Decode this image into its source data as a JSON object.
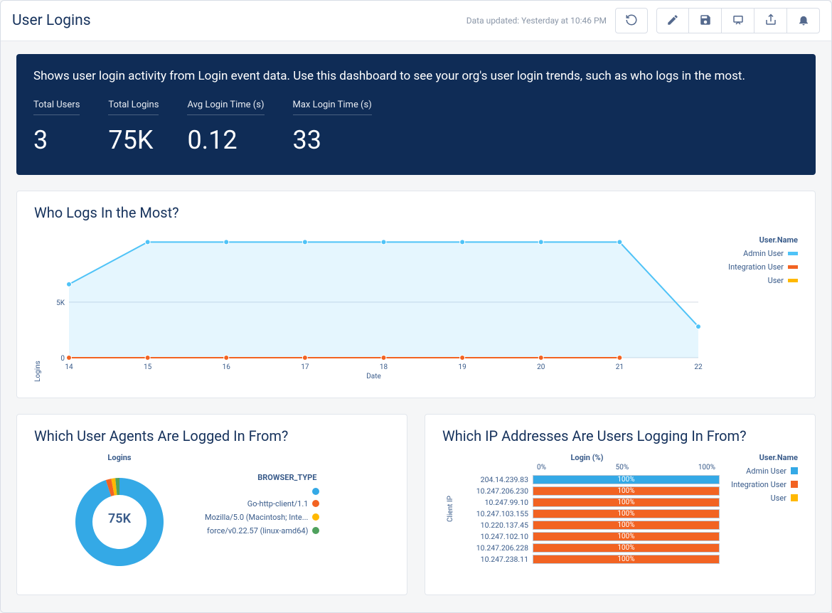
{
  "header": {
    "title": "User Logins",
    "data_updated": "Data updated: Yesterday at 10:46 PM"
  },
  "toolbar_icons": [
    "undo-icon",
    "edit-icon",
    "save-icon",
    "present-icon",
    "share-icon",
    "notify-icon"
  ],
  "description": "Shows user login activity from Login event data. Use this dashboard to see your org's user login trends, such as who logs in the most.",
  "metrics": [
    {
      "label": "Total Users",
      "value": "3"
    },
    {
      "label": "Total Logins",
      "value": "75K"
    },
    {
      "label": "Avg Login Time (s)",
      "value": "0.12"
    },
    {
      "label": "Max Login Time (s)",
      "value": "33"
    }
  ],
  "colors": {
    "admin_user": "#4fc3f7",
    "integration_user": "#f26322",
    "user": "#ffb800",
    "go_http": "#f26322",
    "mozilla": "#ffb800",
    "force": "#4fa15d",
    "browser_unknown": "#34a9e6",
    "grid": "#d3dbe4",
    "axis_text": "#395b8a"
  },
  "chart_data": [
    {
      "id": "line",
      "title": "Who Logs In the Most?",
      "type": "line",
      "xlabel": "Date",
      "ylabel": "Logins",
      "x_ticks": [
        "14",
        "15",
        "16",
        "17",
        "18",
        "19",
        "20",
        "21",
        "22"
      ],
      "y_ticks": [
        {
          "v": 0,
          "label": "0"
        },
        {
          "v": 5000,
          "label": "5K"
        }
      ],
      "ymax": 11000,
      "legend_title": "User.Name",
      "series": [
        {
          "name": "Admin User",
          "color": "#4fc3f7",
          "values": [
            6600,
            10400,
            10400,
            10400,
            10400,
            10400,
            10400,
            10400,
            2800
          ]
        },
        {
          "name": "Integration User",
          "color": "#f26322",
          "values": [
            0,
            0,
            0,
            0,
            0,
            0,
            0,
            0
          ]
        },
        {
          "name": "User",
          "color": "#ffb800",
          "values": []
        }
      ]
    },
    {
      "id": "donut",
      "title": "Which User Agents Are Logged In From?",
      "type": "pie",
      "center_label": "75K",
      "axis_title": "Logins",
      "legend_title": "BROWSER_TYPE",
      "slices": [
        {
          "name": "",
          "color": "#34a9e6",
          "pct": 95
        },
        {
          "name": "Go-http-client/1.1",
          "color": "#f26322",
          "pct": 2
        },
        {
          "name": "Mozilla/5.0 (Macintosh; Inte...",
          "color": "#ffb800",
          "pct": 1.5
        },
        {
          "name": "force/v0.22.57 (linux-amd64)",
          "color": "#4fa15d",
          "pct": 1.5
        }
      ]
    },
    {
      "id": "ipbars",
      "title": "Which IP Addresses Are Users Logging In From?",
      "type": "bar",
      "axis_title": "Login (%)",
      "ticks": [
        "0%",
        "50%",
        "100%"
      ],
      "ylabel": "Client IP",
      "legend_title": "User.Name",
      "legend": [
        {
          "name": "Admin User",
          "color": "#34a9e6"
        },
        {
          "name": "Integration User",
          "color": "#f26322"
        },
        {
          "name": "User",
          "color": "#ffb800"
        }
      ],
      "rows": [
        {
          "label": "204.14.239.83",
          "pct": 100,
          "color": "#34a9e6"
        },
        {
          "label": "10.247.206.230",
          "pct": 100,
          "color": "#f26322"
        },
        {
          "label": "10.247.99.10",
          "pct": 100,
          "color": "#f26322"
        },
        {
          "label": "10.247.103.155",
          "pct": 100,
          "color": "#f26322"
        },
        {
          "label": "10.220.137.45",
          "pct": 100,
          "color": "#f26322"
        },
        {
          "label": "10.247.102.10",
          "pct": 100,
          "color": "#f26322"
        },
        {
          "label": "10.247.206.228",
          "pct": 100,
          "color": "#f26322"
        },
        {
          "label": "10.247.238.11",
          "pct": 100,
          "color": "#f26322"
        }
      ]
    }
  ]
}
